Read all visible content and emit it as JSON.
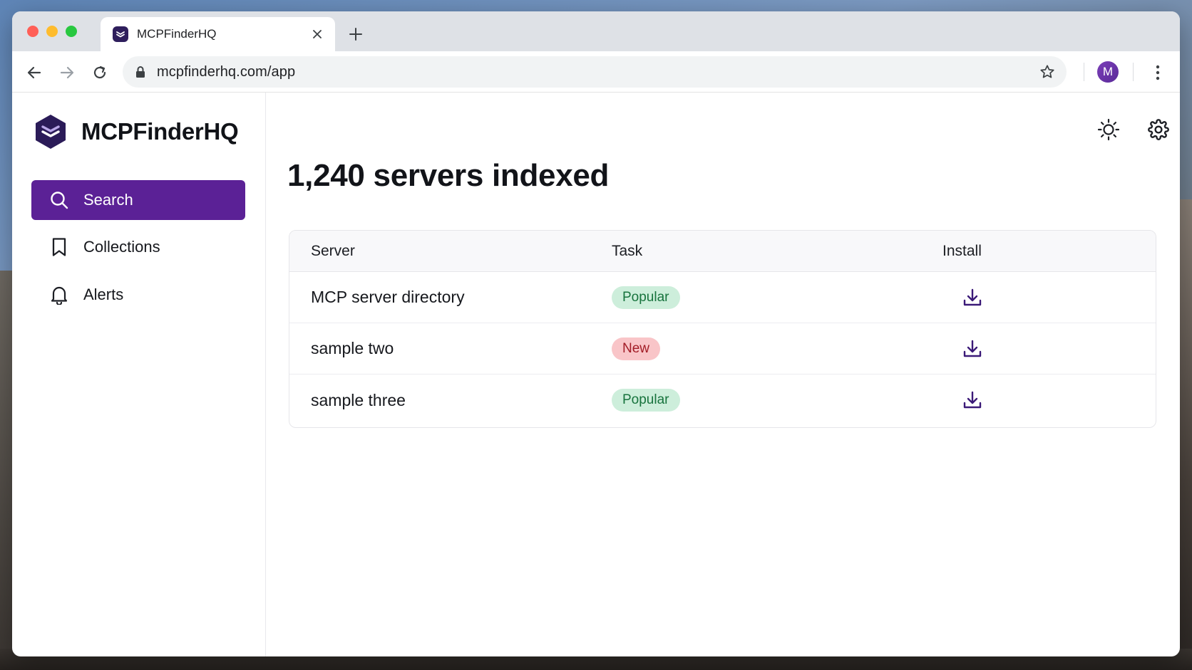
{
  "browser": {
    "tab_title": "MCPFinderHQ",
    "url": "mcpfinderhq.com/app",
    "avatar_initial": "M"
  },
  "sidebar": {
    "brand_name": "MCPFinderHQ",
    "items": [
      {
        "label": "Search",
        "icon": "search-icon",
        "active": true
      },
      {
        "label": "Collections",
        "icon": "bookmark-icon",
        "active": false
      },
      {
        "label": "Alerts",
        "icon": "bell-icon",
        "active": false
      }
    ]
  },
  "main": {
    "headline": "1,240 servers indexed",
    "table": {
      "columns": [
        "Server",
        "Task",
        "Install"
      ],
      "rows": [
        {
          "server": "MCP server directory",
          "task": "Popular",
          "task_kind": "popular"
        },
        {
          "server": "sample two",
          "task": "New",
          "task_kind": "new"
        },
        {
          "server": "sample three",
          "task": "Popular",
          "task_kind": "popular"
        }
      ]
    }
  },
  "colors": {
    "accent": "#5b2196",
    "popular_bg": "#cdeedb",
    "popular_text": "#17733d",
    "new_bg": "#f9c5c8",
    "new_text": "#a21c26"
  }
}
